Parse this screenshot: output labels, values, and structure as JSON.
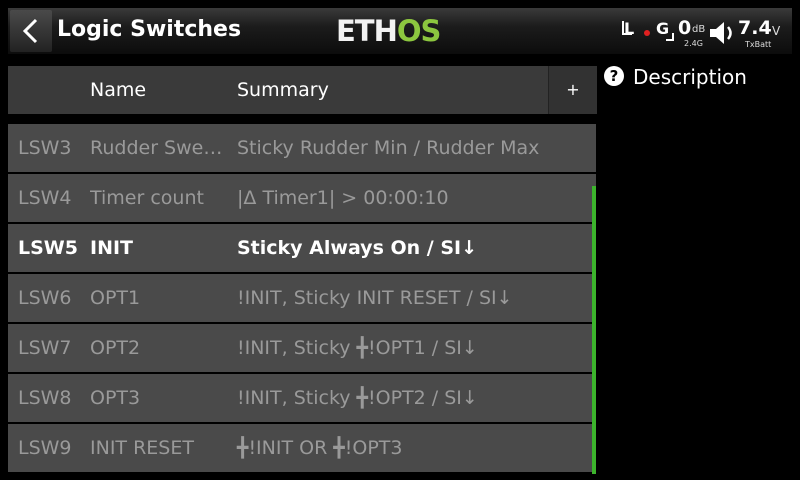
{
  "header": {
    "title": "Logic Switches",
    "logo_left": "ETH",
    "logo_right": "OS",
    "rx_left": "L",
    "rx_right": "G",
    "rssi_value": "0",
    "rssi_unit": "dB",
    "rssi_band": "2.4G",
    "battery_value": "7.4",
    "battery_unit": "V",
    "battery_label": "TxBatt",
    "logo_colors": {
      "left": "#f2f2f2",
      "right": "#8cc63f"
    }
  },
  "table": {
    "columns": [
      "Name",
      "Summary"
    ],
    "add_label": "+",
    "rows": [
      {
        "id": "LSW3",
        "name": "Rudder Swe…",
        "summary": "Sticky Rudder Min / Rudder Max"
      },
      {
        "id": "LSW4",
        "name": "Timer count",
        "summary": "|Δ Timer1| > 00:00:10"
      },
      {
        "id": "LSW5",
        "name": "INIT",
        "summary": "Sticky Always On / SI↓"
      },
      {
        "id": "LSW6",
        "name": "OPT1",
        "summary": "!INIT, Sticky INIT RESET / SI↓"
      },
      {
        "id": "LSW7",
        "name": "OPT2",
        "summary": "!INIT, Sticky ╋!OPT1 / SI↓"
      },
      {
        "id": "LSW8",
        "name": "OPT3",
        "summary": "!INIT, Sticky ╋!OPT2 / SI↓"
      },
      {
        "id": "LSW9",
        "name": "INIT RESET",
        "summary": "╋!INIT OR ╋!OPT3"
      }
    ],
    "selected_id": "LSW5",
    "accent_color": "#3cb42c"
  },
  "side": {
    "description_label": "Description"
  }
}
